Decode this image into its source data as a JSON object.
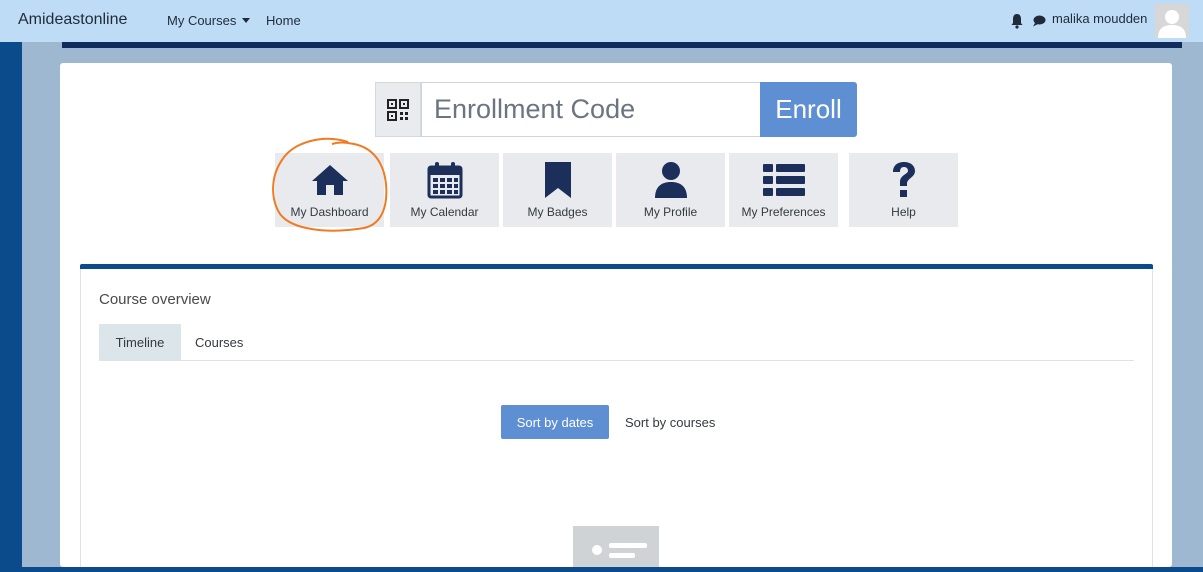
{
  "navbar": {
    "brand": "Amideastonline",
    "my_courses": "My Courses",
    "home": "Home",
    "username": "malika moudden"
  },
  "enroll": {
    "placeholder": "Enrollment Code",
    "button": "Enroll"
  },
  "tiles": [
    {
      "label": "My Dashboard",
      "icon": "home-icon"
    },
    {
      "label": "My Calendar",
      "icon": "calendar-icon"
    },
    {
      "label": "My Badges",
      "icon": "bookmark-icon"
    },
    {
      "label": "My Profile",
      "icon": "user-icon"
    },
    {
      "label": "My Preferences",
      "icon": "list-icon"
    },
    {
      "label": "Help",
      "icon": "question-icon"
    }
  ],
  "course_overview": {
    "title": "Course overview",
    "tabs": [
      "Timeline",
      "Courses"
    ],
    "sort_by_dates": "Sort by dates",
    "sort_by_courses": "Sort by courses"
  },
  "colors": {
    "navbar": "#bfdcf6",
    "accent": "#5f8fd3",
    "brand_blue": "#0b4a8b",
    "tile_icon": "#1c2f5a",
    "annotation": "#f07b22"
  }
}
